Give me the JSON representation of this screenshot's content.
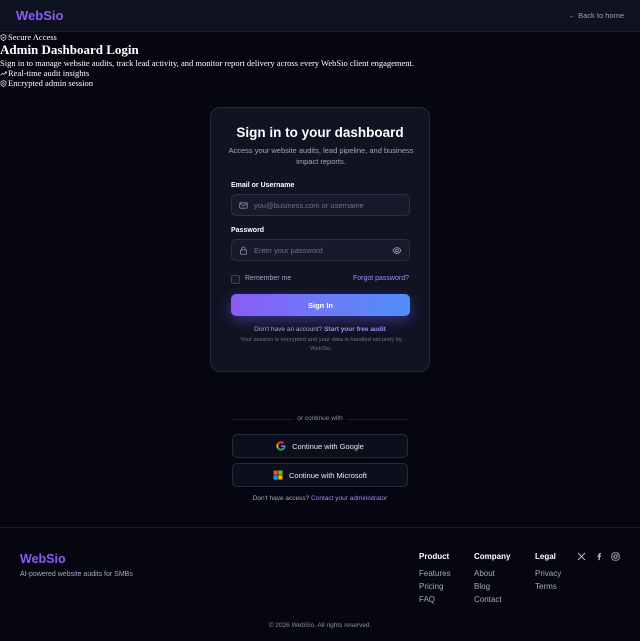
{
  "header": {
    "brand": "WebSio",
    "back_link": "← Back to home"
  },
  "hero": {
    "badge": "Secure Access",
    "title": "Admin Dashboard Login",
    "description": "Sign in to manage website audits, track lead activity, and monitor report delivery across every WebSio client engagement.",
    "feature_1": "Real-time audit insights",
    "feature_2": "Encrypted admin session"
  },
  "login": {
    "title": "Sign in to your dashboard",
    "subtitle": "Access your website audits, lead pipeline, and business impact reports.",
    "email_label": "Email or Username",
    "email_placeholder": "you@business.com or username",
    "password_label": "Password",
    "password_placeholder": "Enter your password",
    "remember_label": "Remember me",
    "forgot_link": "Forgot password?",
    "submit_label": "Sign In",
    "no_account_text": "Don't have an account?",
    "free_audit_link": "Start your free audit",
    "secure_note": "Your session is encrypted and your data is handled securely by WebSio."
  },
  "alt_login": {
    "divider": "or continue with",
    "google_label": "Continue with Google",
    "microsoft_label": "Continue with Microsoft",
    "access_text": "Don't have access?",
    "contact_link": "Contact your administrator"
  },
  "footer": {
    "brand": "WebSio",
    "tagline": "AI-powered website audits for SMBs",
    "columns": [
      {
        "title": "Product",
        "links": [
          "Features",
          "Pricing",
          "FAQ"
        ]
      },
      {
        "title": "Company",
        "links": [
          "About",
          "Blog",
          "Contact"
        ]
      },
      {
        "title": "Legal",
        "links": [
          "Privacy",
          "Terms"
        ]
      }
    ],
    "social_icons": [
      "x-icon",
      "facebook-icon",
      "instagram-icon"
    ],
    "copyright": "© 2026 WebSio. All rights reserved."
  },
  "colors": {
    "background": "#05060f",
    "brand": "#8b5cf6",
    "accent_link": "#9f8cf7",
    "button_gradient_start": "#8b5cf6",
    "button_gradient_end": "#4f8df7"
  }
}
